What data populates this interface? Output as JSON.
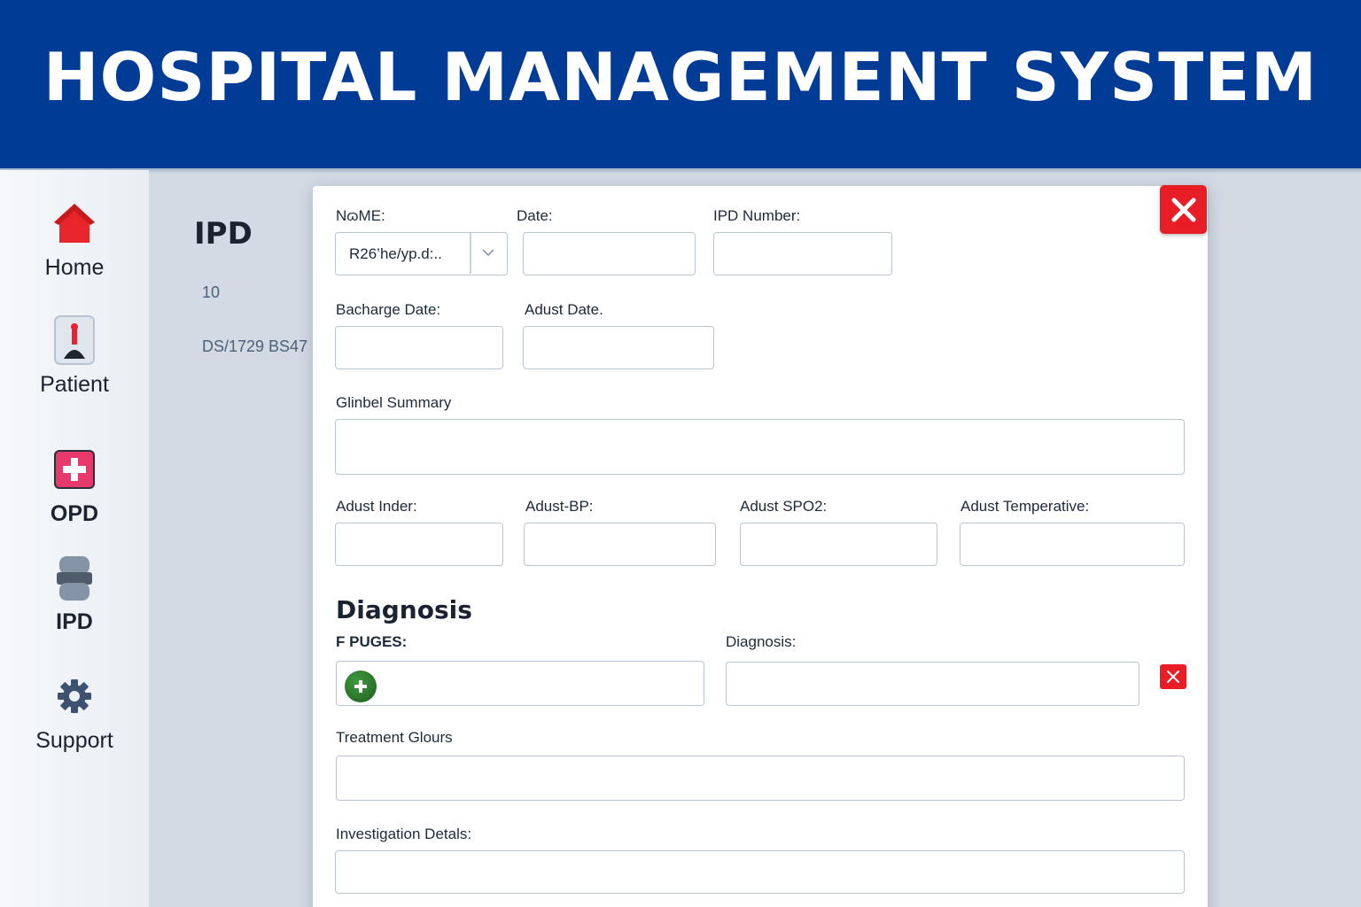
{
  "header": {
    "title": "HOSPITAL MANAGEMENT SYSTEM"
  },
  "sidebar": {
    "items": [
      {
        "label": "Home",
        "icon": "home-icon"
      },
      {
        "label": "Patient",
        "icon": "patient-icon"
      },
      {
        "label": "OPD",
        "icon": "medical-cross-icon"
      },
      {
        "label": "IPD",
        "icon": "bed-icon"
      },
      {
        "label": "Support",
        "icon": "gear-icon"
      }
    ]
  },
  "left_panel": {
    "title": "IPD",
    "values": [
      "10",
      "DS/1729 BS47"
    ]
  },
  "form": {
    "name_label": "NɷME:",
    "name_value": "R26’he/yp.d:..",
    "date_label": "Date:",
    "date_value": "",
    "ipd_number_label": "IPD Number:",
    "ipd_number_value": "",
    "discharge_date_label": "Bacharge Date:",
    "discharge_date_value": "",
    "adust_date_label": "Adust Date.",
    "adust_date_value": "",
    "summary_label": "Glinbel Summary",
    "summary_value": "",
    "inder_label": "Adust Inder:",
    "bp_label": "Adust-BP:",
    "spo2_label": "Adust SPO2:",
    "temp_label": "Adust Temperative:",
    "diagnosis_section_title": "Diagnosis",
    "puges_label": "F PUGES:",
    "diagnosis_label": "Diagnosis:",
    "treatment_label": "Treatment Glours",
    "investigation_label": "Investigation Detals:"
  },
  "colors": {
    "header_bg": "#003c96",
    "close_red": "#e81d25",
    "add_green": "#2a7a2a",
    "opd_pink": "#e8396d"
  }
}
